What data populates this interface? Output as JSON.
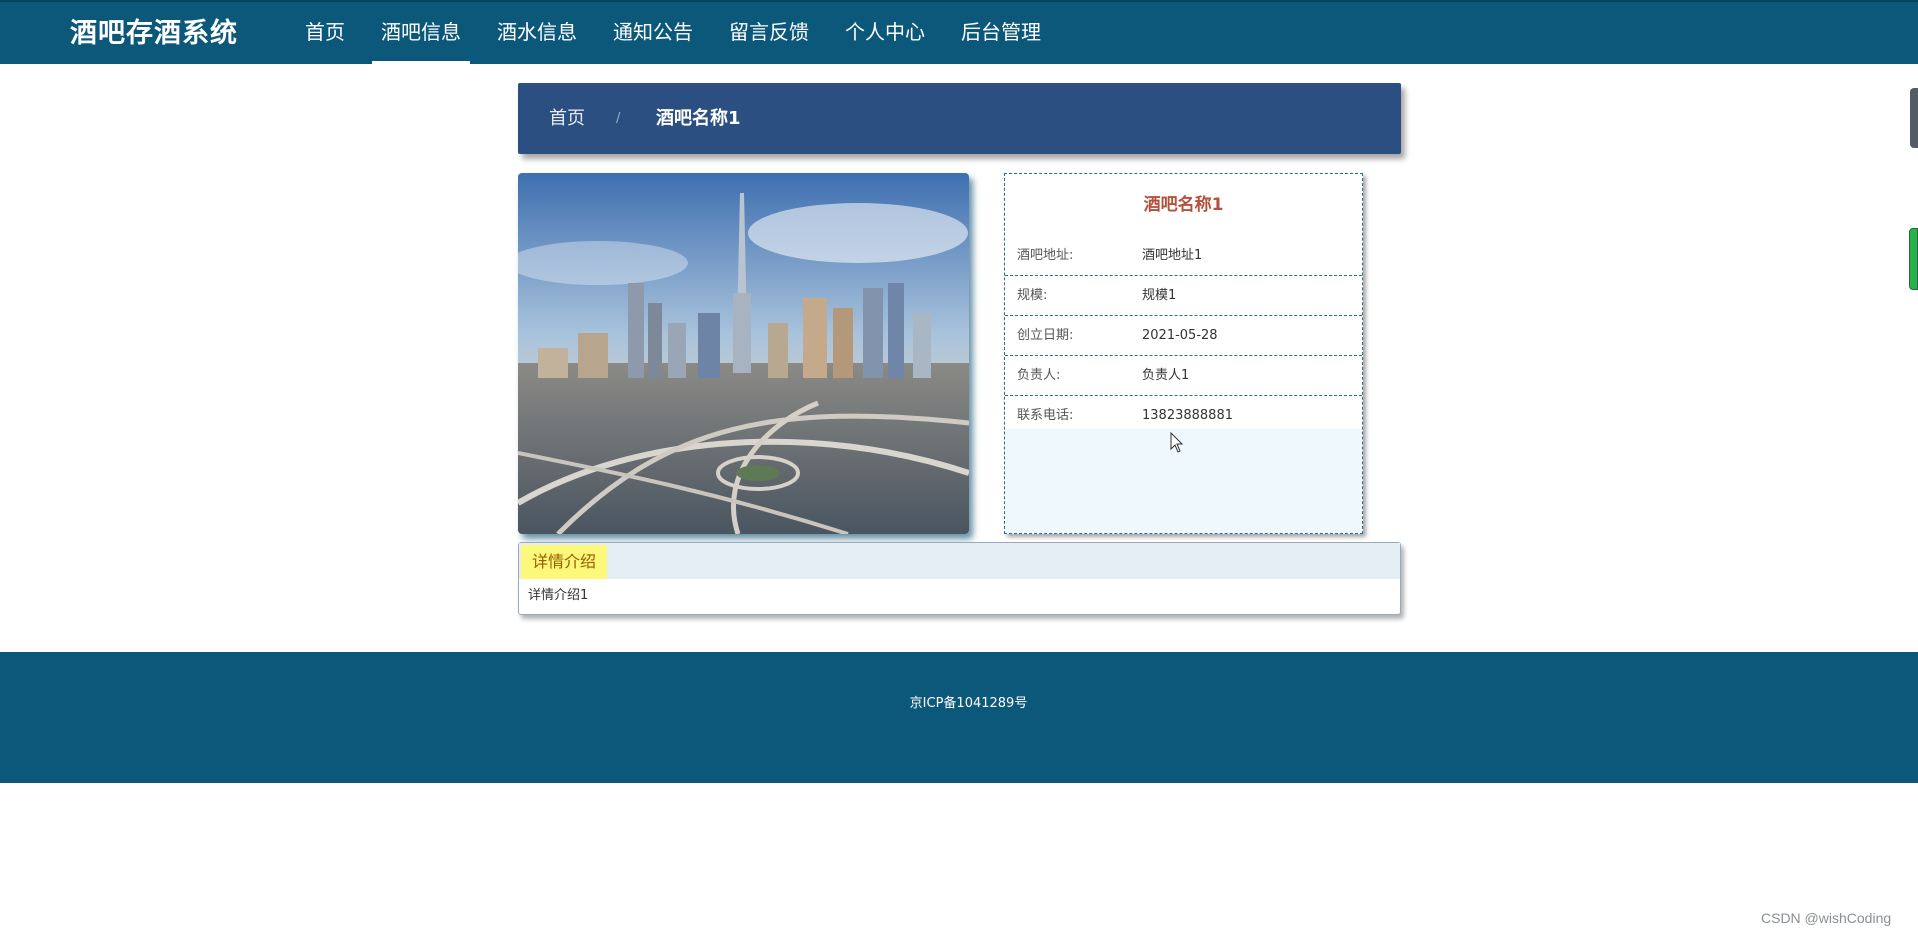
{
  "app": {
    "title": "酒吧存酒系统"
  },
  "nav": {
    "items": [
      {
        "label": "首页"
      },
      {
        "label": "酒吧信息",
        "active": true
      },
      {
        "label": "酒水信息"
      },
      {
        "label": "通知公告"
      },
      {
        "label": "留言反馈"
      },
      {
        "label": "个人中心"
      },
      {
        "label": "后台管理"
      }
    ]
  },
  "breadcrumb": {
    "home": "首页",
    "separator": "/",
    "current": "酒吧名称1"
  },
  "detail_card": {
    "name": "酒吧名称1",
    "fields": [
      {
        "label": "酒吧地址:",
        "value": "酒吧地址1"
      },
      {
        "label": "规模:",
        "value": "规模1"
      },
      {
        "label": "创立日期:",
        "value": "2021-05-28"
      },
      {
        "label": "负责人:",
        "value": "负责人1"
      },
      {
        "label": "联系电话:",
        "value": "13823888881"
      }
    ]
  },
  "intro": {
    "tab": "详情介绍",
    "content": "详情介绍1"
  },
  "footer": {
    "icp": "京ICP备1041289号"
  },
  "watermark": "CSDN @wishCoding",
  "colors": {
    "nav_bg": "#0c587a",
    "breadcrumb_bg": "#2c4f81",
    "title_accent": "#b5503b",
    "intro_tab_bg": "#fbf87a"
  }
}
